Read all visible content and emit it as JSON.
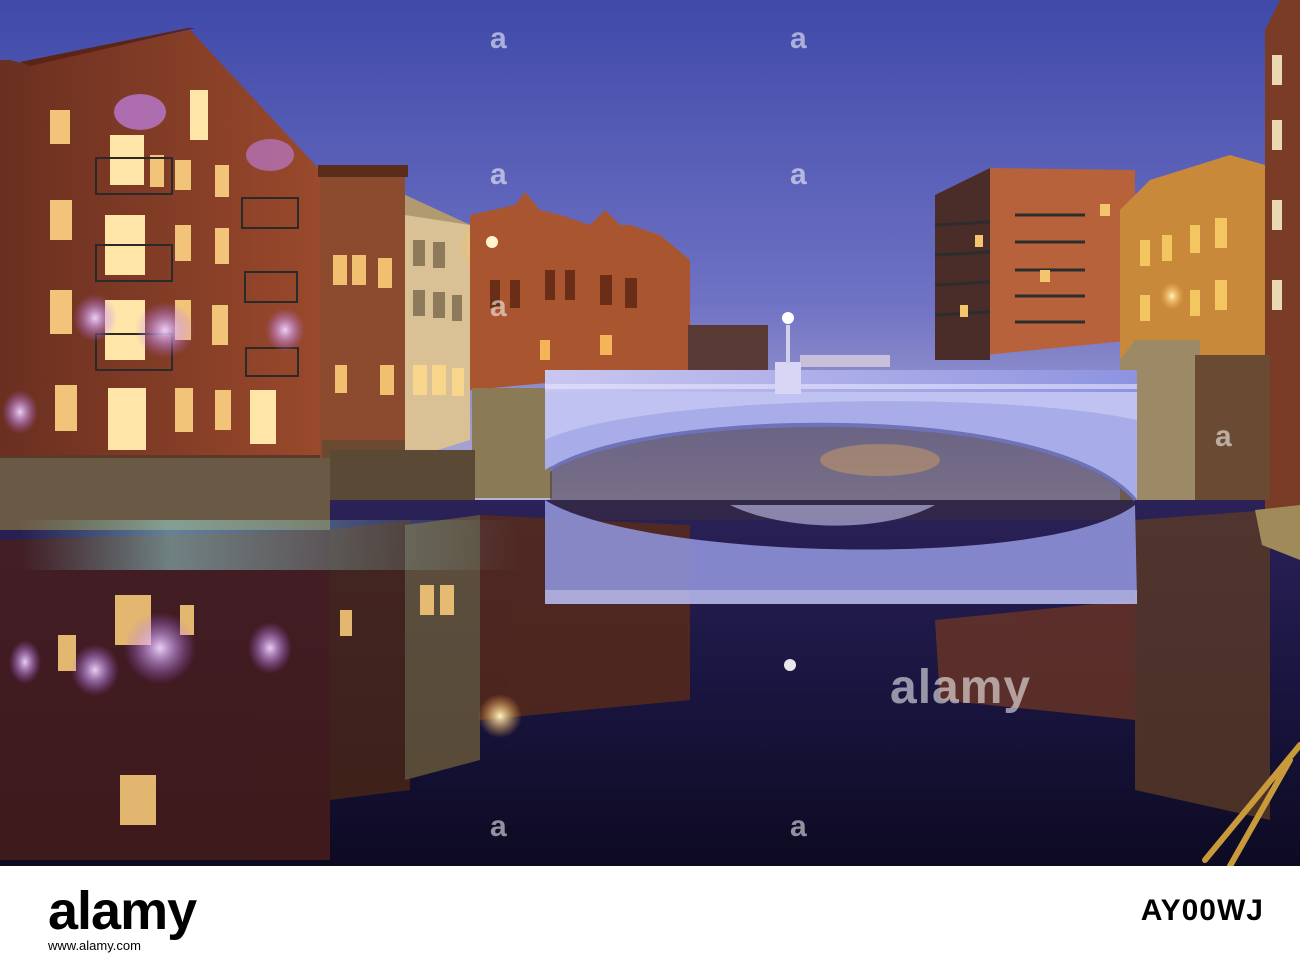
{
  "scene": "Illuminated riverside buildings and a lit cast-iron arch bridge reflected in still water at dusk",
  "watermark": {
    "text": "a",
    "repeat_text": "alamy"
  },
  "footer": {
    "brand": "alamy",
    "url": "www.alamy.com",
    "image_id": "AY00WJ"
  },
  "colors": {
    "sky_top": "#3f49a8",
    "sky_bottom": "#b3b0d8",
    "water": "#14112e",
    "brick": "#8a3f2a",
    "bridge": "#c7c8ee"
  }
}
